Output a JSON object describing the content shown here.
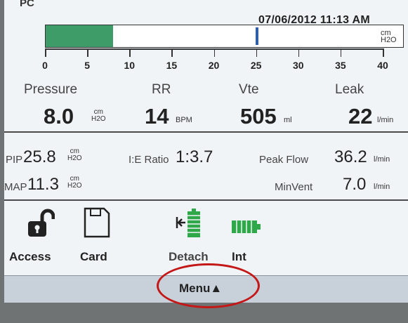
{
  "header": {
    "mode": "PC",
    "datetime": "07/06/2012 11:13 AM"
  },
  "pressure_bar": {
    "unit_line1": "cm",
    "unit_line2": "H2O",
    "fill_value": 8.0,
    "marker_value": 25,
    "ticks": [
      "0",
      "5",
      "10",
      "15",
      "20",
      "25",
      "30",
      "35",
      "40"
    ],
    "range": [
      0,
      40
    ]
  },
  "params": {
    "pressure": {
      "label": "Pressure",
      "value": "8.0",
      "unit1": "cm",
      "unit2": "H2O"
    },
    "rr": {
      "label": "RR",
      "value": "14",
      "unit": "BPM"
    },
    "vte": {
      "label": "Vte",
      "value": "505",
      "unit": "ml"
    },
    "leak": {
      "label": "Leak",
      "value": "22",
      "unit": "l/min"
    }
  },
  "secondary": {
    "pip": {
      "label": "PIP",
      "value": "25.8",
      "unit1": "cm",
      "unit2": "H2O"
    },
    "ie": {
      "label": "I:E Ratio",
      "value": "1:3.7"
    },
    "peak_flow": {
      "label": "Peak Flow",
      "value": "36.2",
      "unit": "l/min"
    },
    "map": {
      "label": "MAP",
      "value": "11.3",
      "unit1": "cm",
      "unit2": "H2O"
    },
    "min_vent": {
      "label": "MinVent",
      "value": "7.0",
      "unit": "l/min"
    }
  },
  "icons": {
    "access": "Access",
    "card": "Card",
    "detach": "Detach",
    "int": "Int"
  },
  "menu": {
    "label": "Menu▲"
  },
  "colors": {
    "bar_fill": "#3d9c68",
    "marker": "#2f5ea8",
    "battery": "#2fa84a",
    "annotation": "#c41717"
  }
}
